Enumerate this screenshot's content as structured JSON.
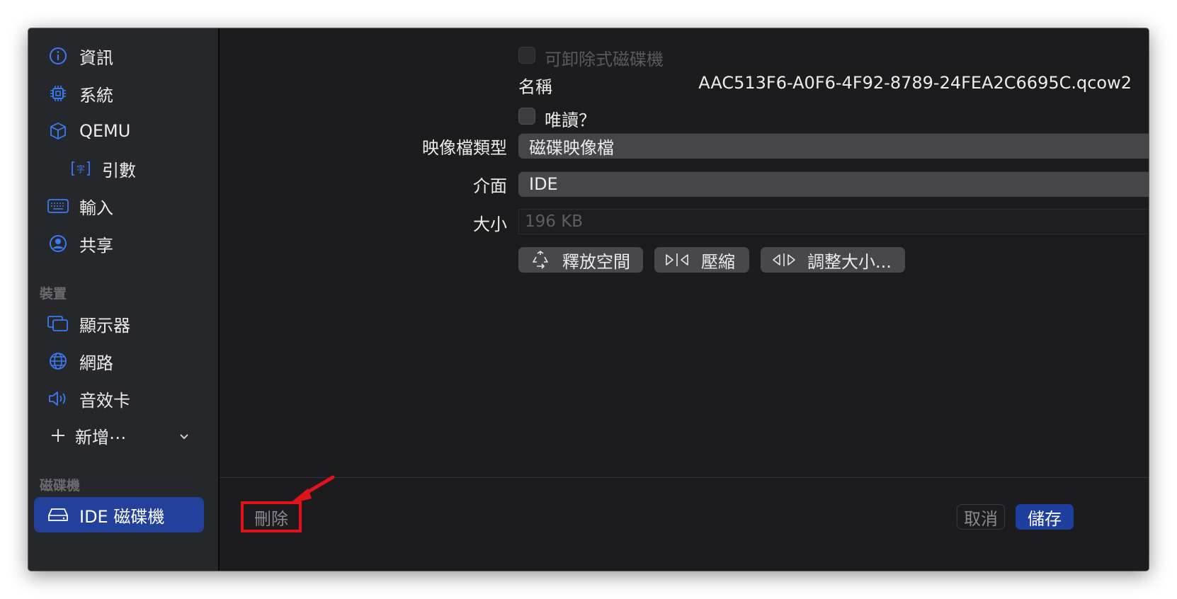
{
  "sidebar": {
    "items": [
      {
        "label": "資訊",
        "icon": "info-icon"
      },
      {
        "label": "系統",
        "icon": "cpu-chip-icon"
      },
      {
        "label": "QEMU",
        "icon": "cube-icon"
      },
      {
        "label": "引數",
        "icon": "argument-icon"
      },
      {
        "label": "輸入",
        "icon": "keyboard-icon"
      },
      {
        "label": "共享",
        "icon": "person-circle-icon"
      }
    ],
    "devices_section": "裝置",
    "device_items": [
      {
        "label": "顯示器",
        "icon": "display-icon"
      },
      {
        "label": "網路",
        "icon": "globe-icon"
      },
      {
        "label": "音效卡",
        "icon": "speaker-icon"
      }
    ],
    "add_item": {
      "label": "新增⋯",
      "icon": "plus-icon"
    },
    "drives_section": "磁碟機",
    "drive_items": [
      {
        "label": "IDE 磁碟機",
        "icon": "drive-icon",
        "selected": true
      }
    ]
  },
  "main": {
    "removable": {
      "label": "可卸除式磁碟機",
      "checked": false,
      "enabled": false
    },
    "name": {
      "label": "名稱",
      "value": "AAC513F6-A0F6-4F92-8789-24FEA2C6695C.qcow2"
    },
    "readonly": {
      "label": "唯讀？",
      "checked": false
    },
    "image_type": {
      "label": "映像檔類型",
      "value": "磁碟映像檔"
    },
    "interface": {
      "label": "介面",
      "value": "IDE"
    },
    "size": {
      "label": "大小",
      "placeholder": "196 KB"
    },
    "buttons": {
      "reclaim": "釋放空間",
      "compress": "壓縮",
      "resize": "調整大小..."
    }
  },
  "footer": {
    "delete": "刪除",
    "cancel": "取消",
    "save": "儲存"
  },
  "colors": {
    "accent": "#2a5bd7",
    "selected_bg": "#23419a",
    "annotation_red": "#e0121b"
  }
}
